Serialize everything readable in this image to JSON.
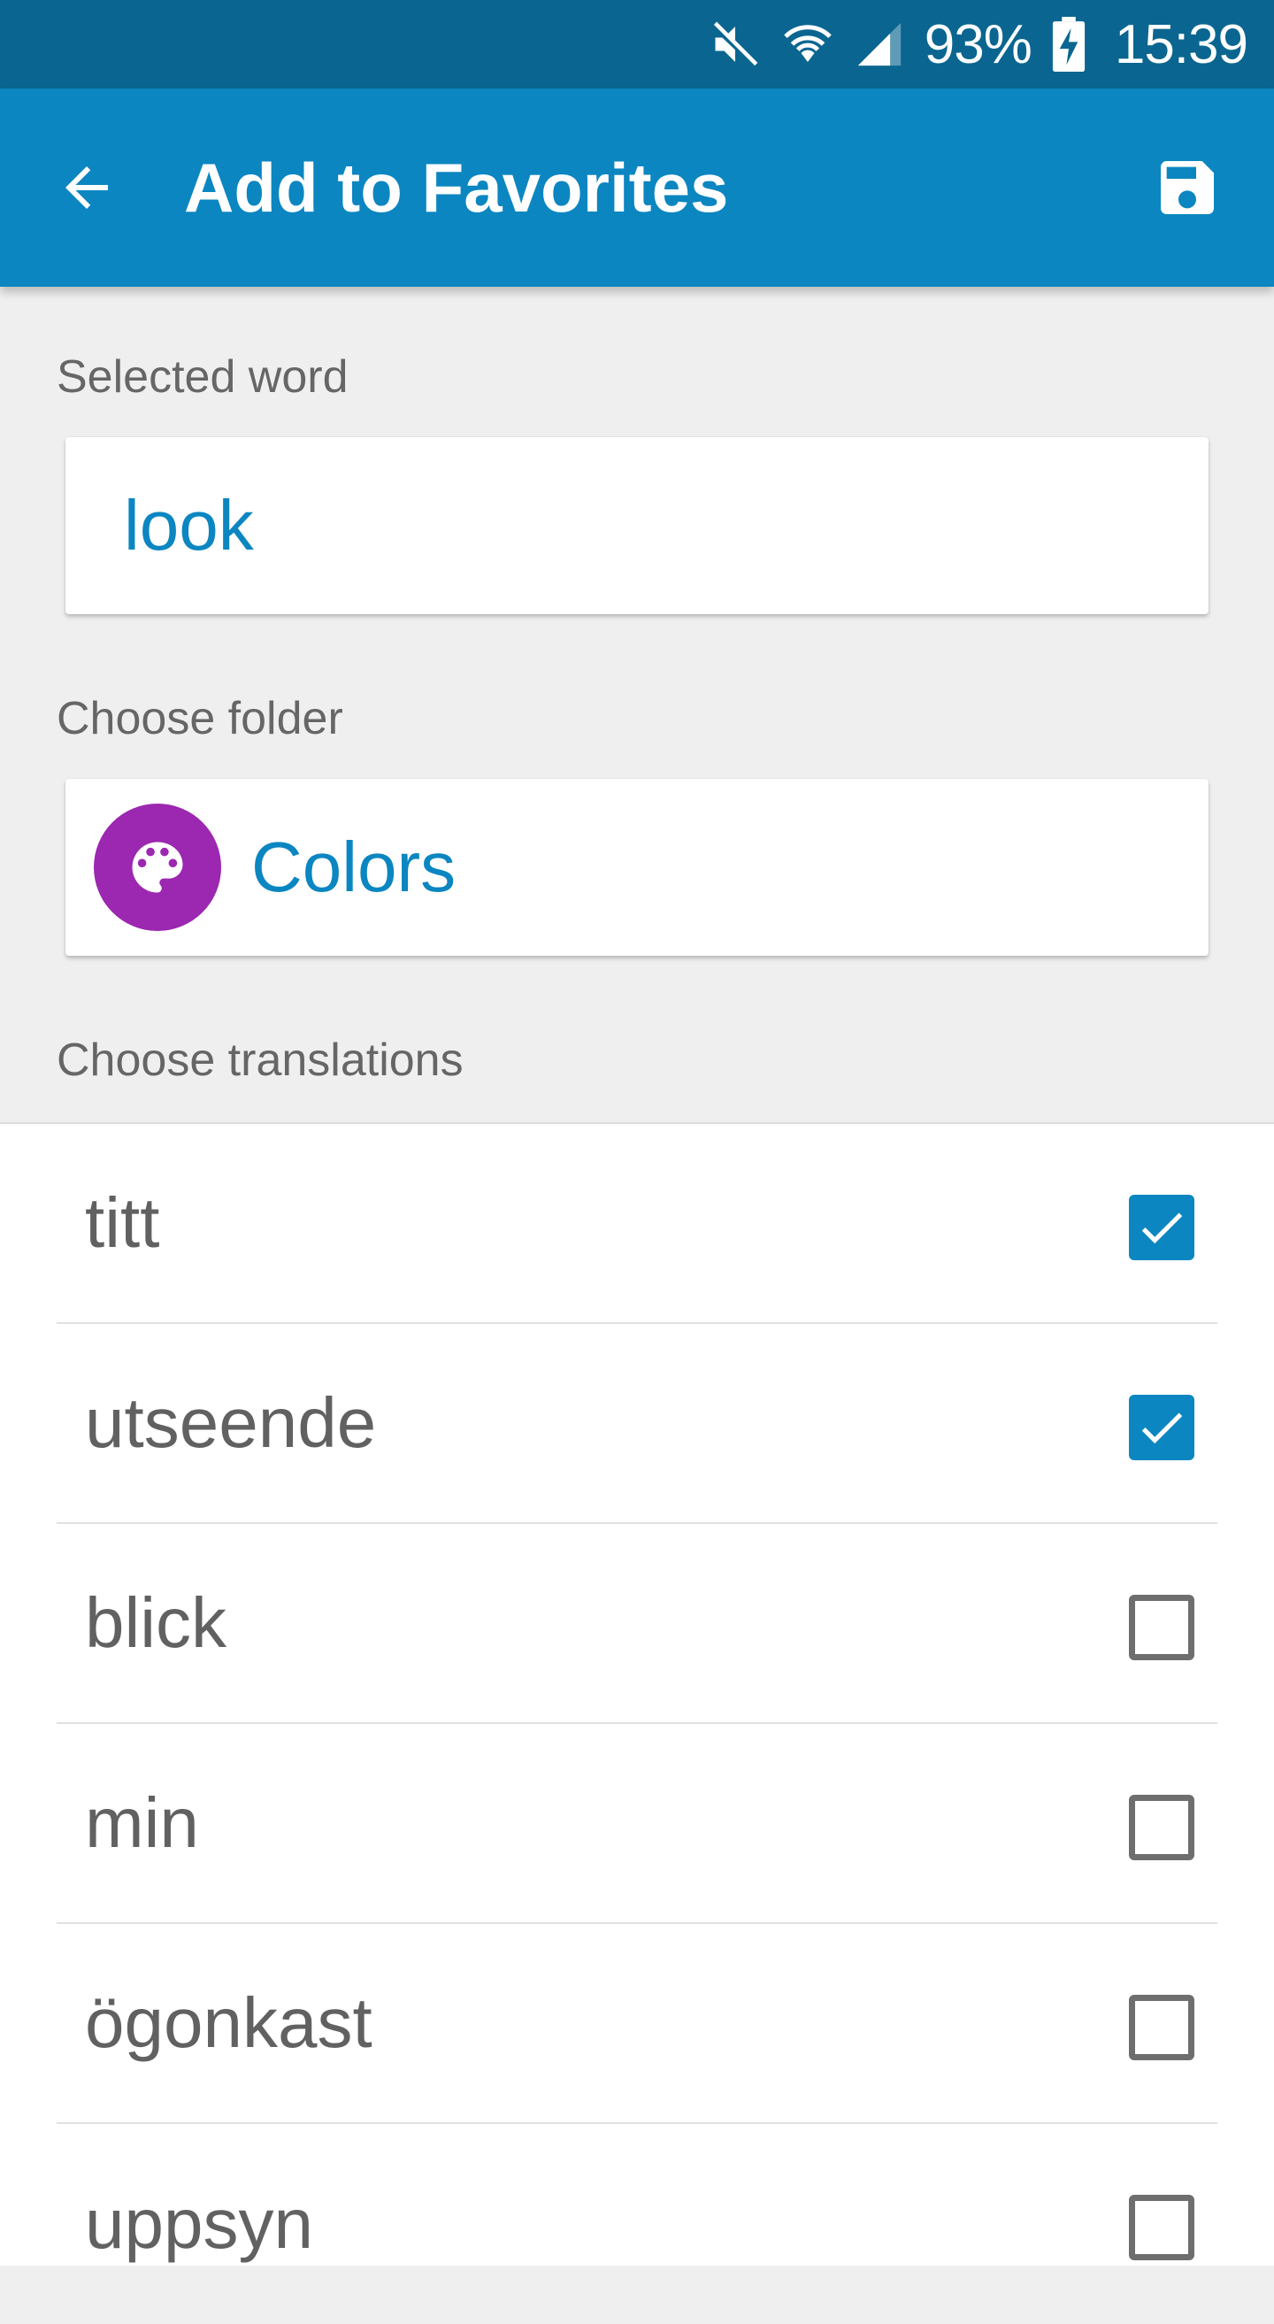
{
  "status_bar": {
    "icons": [
      "mute-icon",
      "wifi-icon",
      "signal-icon",
      "battery-charging-icon"
    ],
    "battery": "93%",
    "time": "15:39"
  },
  "app_bar": {
    "title": "Add to Favorites",
    "back_icon": "arrow-back-icon",
    "save_icon": "save-icon"
  },
  "selected_word": {
    "label": "Selected word",
    "value": "look"
  },
  "folder": {
    "label": "Choose folder",
    "name": "Colors",
    "icon": "palette-icon",
    "color": "#9c27b0"
  },
  "translations": {
    "label": "Choose translations",
    "items": [
      {
        "text": "titt",
        "checked": true
      },
      {
        "text": "utseende",
        "checked": true
      },
      {
        "text": "blick",
        "checked": false
      },
      {
        "text": "min",
        "checked": false
      },
      {
        "text": "ögonkast",
        "checked": false
      },
      {
        "text": "uppsyn",
        "checked": false
      }
    ]
  },
  "colors": {
    "status_bar": "#0a6690",
    "app_bar": "#0b86c1",
    "accent": "#0b86c1"
  }
}
